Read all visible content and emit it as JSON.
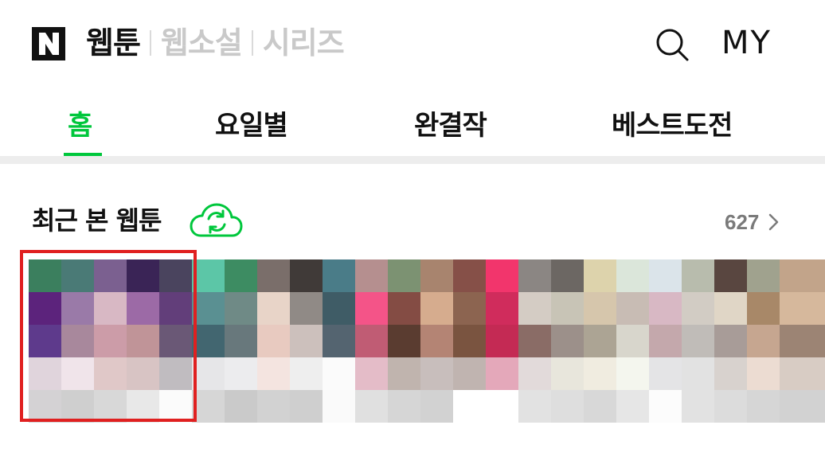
{
  "header": {
    "logo_letter": "N",
    "brand_tabs": [
      {
        "label": "웹툰",
        "active": true
      },
      {
        "label": "웹소설",
        "active": false
      },
      {
        "label": "시리즈",
        "active": false
      }
    ],
    "my_label": "MY",
    "search_icon": "search-icon"
  },
  "nav": {
    "items": [
      {
        "label": "홈",
        "active": true
      },
      {
        "label": "요일별",
        "active": false
      },
      {
        "label": "완결작",
        "active": false
      },
      {
        "label": "베스트도전",
        "active": false
      }
    ],
    "accent_color": "#00c73c"
  },
  "recent": {
    "title": "최근 본 웹툰",
    "sync_icon": "refresh-cloud-icon",
    "count": "627",
    "chevron_icon": "chevron-right-icon",
    "highlight_color": "#e02020"
  },
  "mosaic_colors": [
    [
      "#3b7f5e",
      "#4a7a76",
      "#7b6090",
      "#3a2456",
      "#4a445e",
      "#5cc6a7",
      "#3d8c62",
      "#7a6e6a",
      "#403a38",
      "#4a7c88",
      "#b58f8f",
      "#7c9272",
      "#a8846e",
      "#865048",
      "#f2356c",
      "#8b8683",
      "#6c6763",
      "#ddd3ac",
      "#dbe6da",
      "#dbe4ea",
      "#b8bcad",
      "#594640",
      "#a0a28e",
      "#c2a48a",
      "#c2a48a"
    ],
    [
      "#5c237c",
      "#9a7aa8",
      "#d8b8c4",
      "#9c6aa6",
      "#623e7a",
      "#5a9092",
      "#6f8a86",
      "#e8d4c8",
      "#908a86",
      "#3f5c66",
      "#f45488",
      "#844c44",
      "#d6ac8e",
      "#8c6450",
      "#d02c5c",
      "#d4ccc4",
      "#c8c4b6",
      "#d6c6ac",
      "#c8bcb4",
      "#d8b8c4",
      "#d2ccc4",
      "#e0d6c6",
      "#a88868",
      "#d6b89c",
      "#d6b89c"
    ],
    [
      "#5e3a8c",
      "#a8889c",
      "#cc9ca8",
      "#c09498",
      "#6a5876",
      "#426670",
      "#68787c",
      "#e8cac0",
      "#ccc0bc",
      "#546470",
      "#c05c74",
      "#5a3c30",
      "#b48474",
      "#7a5440",
      "#c42a54",
      "#8a6c66",
      "#9c908a",
      "#aca494",
      "#d8d6cc",
      "#c4a8ac",
      "#c0bcb8",
      "#a89c98",
      "#c6a690",
      "#9c8474",
      "#9c8474"
    ],
    [
      "#e0d4dc",
      "#f0e4ea",
      "#e0c8c8",
      "#d8c4c4",
      "#c0bcc0",
      "#e6e6e8",
      "#ececee",
      "#f4e4e0",
      "#eeeeee",
      "#fbfbfb",
      "#e4bcc8",
      "#c0b4ae",
      "#c8bebc",
      "#c0b4b0",
      "#e4a8ba",
      "#e2dada",
      "#e8e6dc",
      "#f0ece0",
      "#f4f6ee",
      "#e4e4e6",
      "#e2e2e2",
      "#d8d2ce",
      "#ecdcd2",
      "#d8ccc4",
      "#d8ccc4"
    ],
    [
      "#d4d2d4",
      "#cfcfcf",
      "#d8d8d8",
      "#e8e8e8",
      "#fbfbfb",
      "#d6d6d6",
      "#cacaca",
      "#d2d2d2",
      "#cfcfcf",
      "#fafafa",
      "#e0e0e0",
      "#d6d6d6",
      "#d2d2d2",
      "#ffffff",
      "#ffffff",
      "#e2e2e2",
      "#dedede",
      "#d8d8d8",
      "#e6e6e6",
      "#fcfcfc",
      "#e2e2e2",
      "#dcdcdc",
      "#d6d6d6",
      "#d2d2d2",
      "#d2d2d2"
    ]
  ]
}
